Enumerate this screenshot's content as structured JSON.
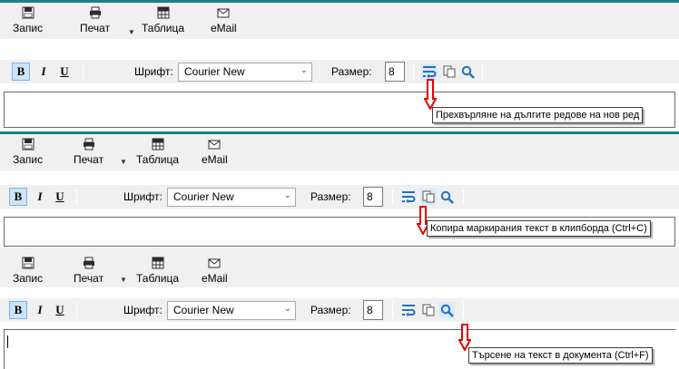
{
  "toolbar": {
    "save_label": "Запис",
    "print_label": "Печат",
    "table_label": "Таблица",
    "email_label": "eMail"
  },
  "format": {
    "bold_label": "B",
    "italic_label": "I",
    "underline_label": "U",
    "font_label": "Шрифт:",
    "font_value": "Courier New",
    "size_label": "Размер:",
    "size_value": "8"
  },
  "icons": {
    "save": "save-icon",
    "print": "printer-icon",
    "table": "table-icon",
    "email": "envelope-icon",
    "wrap": "word-wrap-icon",
    "copy": "copy-icon",
    "search": "magnifier-icon"
  },
  "tooltips": {
    "wrap": "Прехвърляне на дългите редове на нов ред",
    "copy": "Копира маркирания текст в клипборда (Ctrl+C)",
    "search": "Търсене на текст в документа (Ctrl+F)"
  },
  "colors": {
    "accent": "#1e7f84",
    "arrow": "#e60000",
    "icon_blue": "#1f6fc5"
  }
}
